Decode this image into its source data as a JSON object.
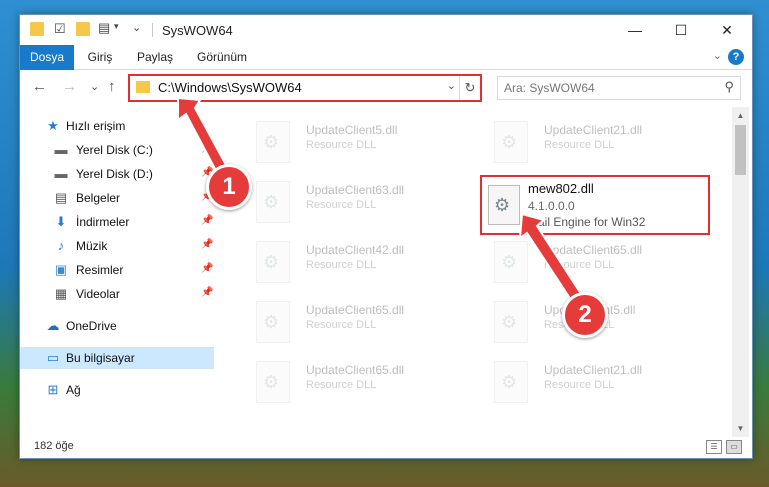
{
  "window": {
    "title": "SysWOW64",
    "minimize": "—",
    "maximize": "☐",
    "close": "✕"
  },
  "ribbon": {
    "tabs": [
      "Dosya",
      "Giriş",
      "Paylaş",
      "Görünüm"
    ],
    "help": "?",
    "collapse": "⌄"
  },
  "nav": {
    "back": "←",
    "forward": "→",
    "recent": "⌄",
    "up": "↑",
    "address": "C:\\Windows\\SysWOW64",
    "address_dropdown": "⌄",
    "refresh": "↻",
    "search_placeholder": "Ara: SysWOW64",
    "search_icon": "⚲"
  },
  "sidebar": {
    "items": [
      {
        "label": "Hızlı erişim",
        "icon": "star-icon",
        "glyph": "★"
      },
      {
        "label": "Yerel Disk (C:)",
        "icon": "drive-icon",
        "glyph": "▬"
      },
      {
        "label": "Yerel Disk (D:)",
        "icon": "drive-icon",
        "glyph": "▬"
      },
      {
        "label": "Belgeler",
        "icon": "documents-icon",
        "glyph": "▤"
      },
      {
        "label": "İndirmeler",
        "icon": "downloads-icon",
        "glyph": "⬇"
      },
      {
        "label": "Müzik",
        "icon": "music-icon",
        "glyph": "♪"
      },
      {
        "label": "Resimler",
        "icon": "pictures-icon",
        "glyph": "▣"
      },
      {
        "label": "Videolar",
        "icon": "videos-icon",
        "glyph": "▦"
      },
      {
        "label": "OneDrive",
        "icon": "cloud-icon",
        "glyph": "☁"
      },
      {
        "label": "Bu bilgisayar",
        "icon": "computer-icon",
        "glyph": "▭"
      },
      {
        "label": "Ağ",
        "icon": "network-icon",
        "glyph": "⊞"
      }
    ],
    "pin_glyph": "📌"
  },
  "files": [
    {
      "name": "UpdateClient5.dll",
      "desc": "Resource DLL"
    },
    {
      "name": "UpdateClient21.dll",
      "desc": "Resource DLL"
    },
    {
      "name": "UpdateClient63.dll",
      "desc": "Resource DLL"
    },
    {
      "name": "UpdateClient42.dll",
      "desc": "Resource DLL"
    },
    {
      "name": "UpdateClient65.dll",
      "desc": "Resource DLL"
    },
    {
      "name": "UpdateClient65.dll",
      "desc": "Resource DLL"
    },
    {
      "name": "UpdateClient5.dll",
      "desc": "Resource DLL"
    },
    {
      "name": "UpdateClient65.dll",
      "desc": "Resource DLL"
    },
    {
      "name": "UpdateClient21.dll",
      "desc": "Resource DLL"
    }
  ],
  "highlighted_file": {
    "name": "mew802.dll",
    "version": "4.1.0.0.0",
    "desc": "Mail Engine for Win32"
  },
  "status": {
    "count": "182 öğe"
  },
  "annotations": {
    "badge1": "1",
    "badge2": "2",
    "color": "#e53b3b"
  },
  "colors": {
    "accent": "#1979ca",
    "highlight_border": "#e03030",
    "selected_bg": "#cce8ff"
  }
}
